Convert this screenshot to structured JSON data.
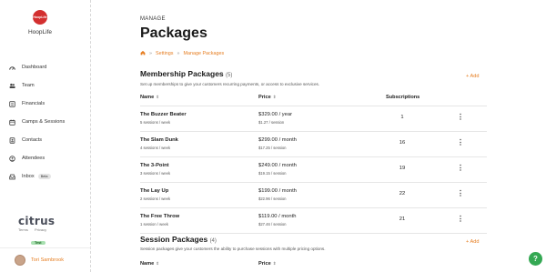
{
  "sidebar": {
    "logo_text": "HoopLife",
    "org_name": "HoopLife",
    "items": [
      {
        "label": "Dashboard",
        "icon": "dashboard-icon"
      },
      {
        "label": "Team",
        "icon": "team-icon"
      },
      {
        "label": "Financials",
        "icon": "financials-icon"
      },
      {
        "label": "Camps & Sessions",
        "icon": "calendar-icon"
      },
      {
        "label": "Contacts",
        "icon": "contacts-icon"
      },
      {
        "label": "Attendees",
        "icon": "attendees-icon"
      },
      {
        "label": "Inbox",
        "icon": "inbox-icon",
        "badge": "Beta"
      }
    ],
    "footer": {
      "brand": "citrus",
      "links": [
        "Terms",
        "Privacy"
      ],
      "env_badge": "Test"
    },
    "user": {
      "name": "Tori Sambrook"
    }
  },
  "header": {
    "section": "MANAGE",
    "title": "Packages",
    "breadcrumb": [
      "Settings",
      "Manage Packages"
    ]
  },
  "membership": {
    "title": "Membership Packages",
    "count": "(5)",
    "description": "Set up memberships to give your customers recurring payments, or access to exclusive services.",
    "add_label": "+ Add",
    "columns": {
      "name": "Name",
      "price": "Price",
      "subscriptions": "Subscriptions"
    },
    "rows": [
      {
        "name": "The Buzzer Beater",
        "sessions": "5 sessions / week",
        "price": "$329.00 / year",
        "per_session": "$1.27 / session",
        "subscriptions": "1"
      },
      {
        "name": "The Slam Dunk",
        "sessions": "4 sessions / week",
        "price": "$299.00 / month",
        "per_session": "$17.25 / session",
        "subscriptions": "16"
      },
      {
        "name": "The 3-Point",
        "sessions": "3 sessions / week",
        "price": "$249.00 / month",
        "per_session": "$19.15 / session",
        "subscriptions": "19"
      },
      {
        "name": "The Lay Up",
        "sessions": "2 sessions / week",
        "price": "$199.00 / month",
        "per_session": "$22.96 / session",
        "subscriptions": "22"
      },
      {
        "name": "The Free Throw",
        "sessions": "1 session / week",
        "price": "$119.00 / month",
        "per_session": "$27.46 / session",
        "subscriptions": "21"
      }
    ]
  },
  "session": {
    "title": "Session Packages",
    "count": "(4)",
    "description": "Session packages give your customers the ability to purchase sessions with multiple pricing options.",
    "add_label": "+ Add",
    "columns": {
      "name": "Name",
      "price": "Price"
    }
  },
  "help": {
    "label": "?"
  },
  "colors": {
    "accent": "#e67e22",
    "help": "#34a853",
    "logo": "#d32f2f"
  }
}
